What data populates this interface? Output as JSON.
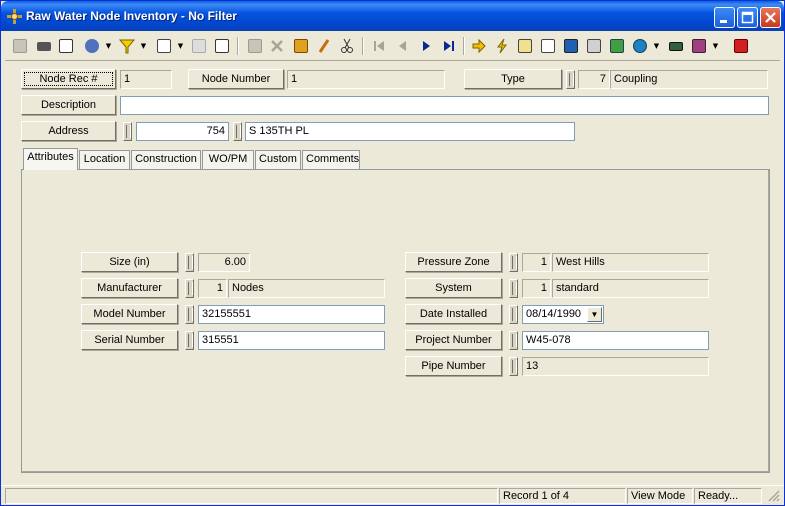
{
  "window": {
    "title": "Raw Water Node Inventory - No Filter"
  },
  "toolbar": {
    "icons": [
      "new-icon",
      "print-icon",
      "print-preview-icon",
      "search-icon",
      "filter-icon",
      "report-icon",
      "copy-icon",
      "paste-icon",
      "save-icon",
      "delete-icon",
      "stamp-icon",
      "edit-icon",
      "cut-icon",
      "first-record-icon",
      "prev-record-icon",
      "next-record-icon",
      "last-record-icon",
      "goto-arrow-icon",
      "lightning-icon",
      "tree-icon",
      "hierarchy-icon",
      "map-view-icon",
      "calculator-icon",
      "image-icon",
      "globe-icon",
      "keyboard-icon",
      "book-icon",
      "exit-icon"
    ]
  },
  "header": {
    "node_rec_label": "Node Rec #",
    "node_rec_value": "1",
    "node_number_label": "Node Number",
    "node_number_value": "1",
    "type_label": "Type",
    "type_code": "7",
    "type_value": "Coupling",
    "description_label": "Description",
    "description_value": "",
    "address_label": "Address",
    "address_number": "754",
    "address_street": "S 135TH PL"
  },
  "tabs": [
    {
      "label": "Attributes",
      "active": true
    },
    {
      "label": "Location"
    },
    {
      "label": "Construction"
    },
    {
      "label": "WO/PM"
    },
    {
      "label": "Custom"
    },
    {
      "label": "Comments"
    }
  ],
  "attributes": {
    "size_label": "Size (in)",
    "size_value": "6.00",
    "manufacturer_label": "Manufacturer",
    "manufacturer_code": "1",
    "manufacturer_value": "Nodes",
    "model_label": "Model Number",
    "model_value": "32155551",
    "serial_label": "Serial Number",
    "serial_value": "315551",
    "pressure_zone_label": "Pressure Zone",
    "pressure_zone_code": "1",
    "pressure_zone_value": "West Hills",
    "system_label": "System",
    "system_code": "1",
    "system_value": "standard",
    "date_installed_label": "Date Installed",
    "date_installed_value": "08/14/1990",
    "project_label": "Project Number",
    "project_value": "W45-078",
    "pipe_label": "Pipe Number",
    "pipe_value": "13"
  },
  "statusbar": {
    "record": "Record 1 of 4",
    "mode": "View Mode",
    "state": "Ready..."
  }
}
